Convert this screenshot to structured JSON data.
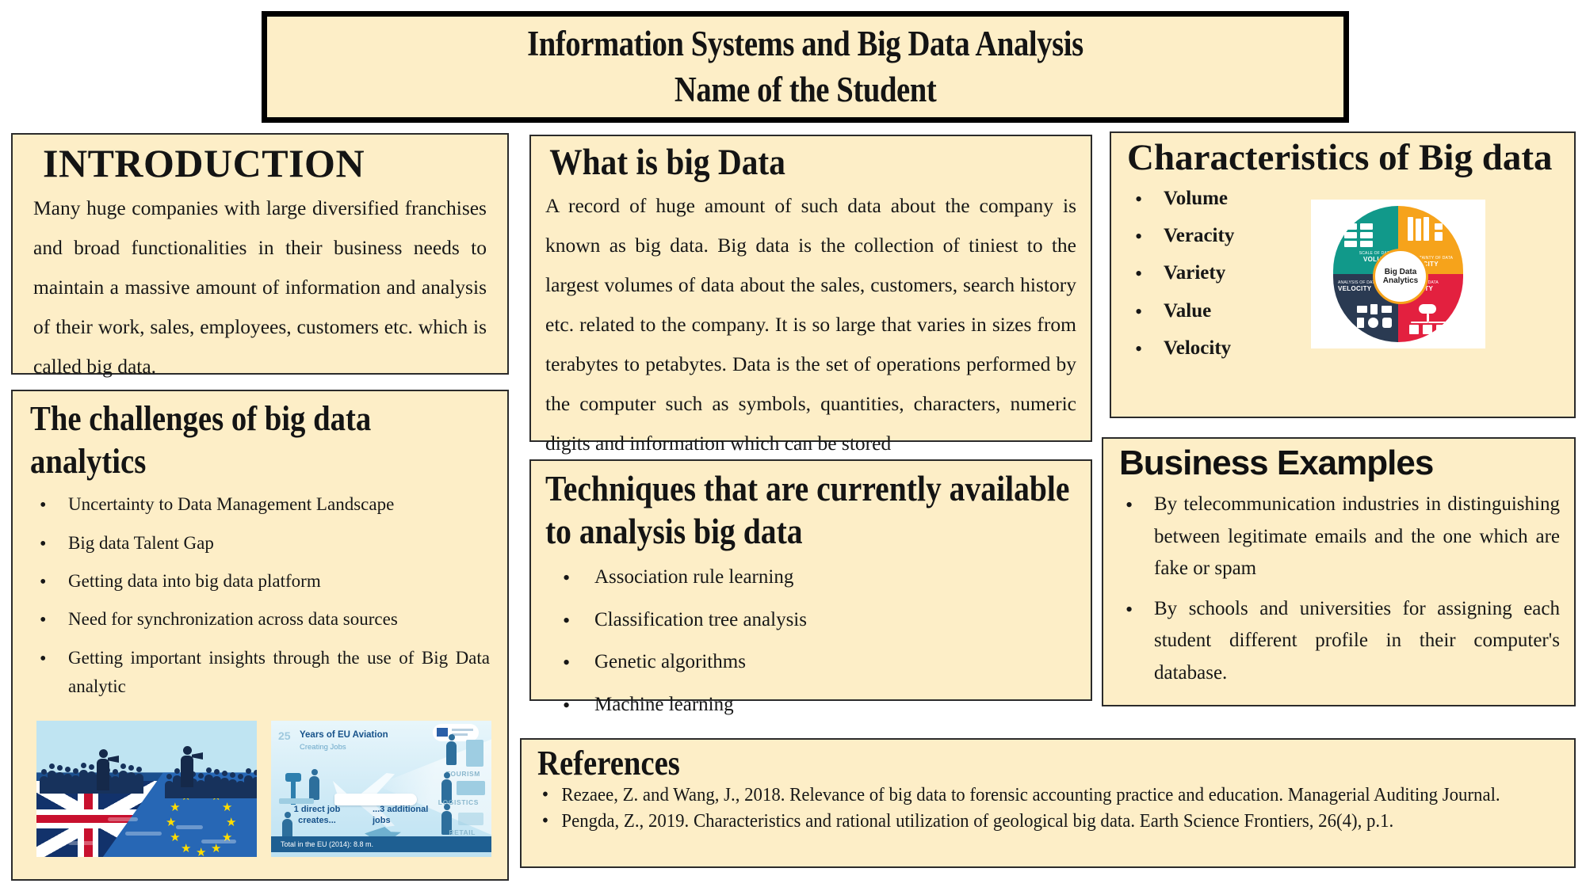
{
  "poster": {
    "title_line1": "Information Systems and Big Data Analysis",
    "title_line2": "Name of the Student",
    "panel_bg_color": "#fdeec7",
    "page_bg_color": "#ffffff"
  },
  "introduction": {
    "heading": "INTRODUCTION",
    "paragraph": "Many huge companies with large diversified franchises and broad functionalities in their business needs to maintain a massive amount of information and analysis of their work, sales, employees, customers etc. which is called big data."
  },
  "challenges": {
    "heading": "The challenges of big data analytics",
    "items": [
      "Uncertainty to Data Management Landscape",
      "Big data Talent Gap",
      "Getting data into big data platform",
      "Need for synchronization across  data sources",
      "Getting important insights through the use of Big Data analytic"
    ],
    "image_brexit": {
      "name": "brexit-uk-eu-boats-illustration"
    },
    "image_aviation": {
      "title": "Years of EU Aviation",
      "subtitle": "Creating Jobs",
      "badge": "25",
      "left_text": "1 direct job creates...",
      "right_text": "...3 additional jobs",
      "labels": [
        "TOURISM",
        "LOGISTICS",
        "RETAIL"
      ],
      "footer": "Total in the EU (2014): 8.8 m."
    }
  },
  "whatis": {
    "heading": "What is big Data",
    "paragraph": "A record of huge amount of such data about the company is known as big data. Big data is the collection of tiniest to the largest volumes of data about the sales, customers, search history etc. related to the company. It is so large that varies in sizes from terabytes to petabytes. Data is the set of operations performed by the computer such as symbols, quantities, characters, numeric digits and information which can be stored"
  },
  "techniques": {
    "heading": "Techniques that are currently available to analysis big data",
    "items": [
      "Association rule learning",
      "Classification tree analysis",
      "Genetic algorithms",
      "Machine learning"
    ]
  },
  "characteristics": {
    "heading": "Characteristics of Big data",
    "items": [
      "Volume",
      "Veracity",
      "Variety",
      "Value",
      "Velocity"
    ],
    "diagram": {
      "center_line1": "Big Data",
      "center_line2": "Analytics",
      "quadrants": [
        {
          "caption": "SCALE OF DATA",
          "label": "VOLUME",
          "color": "#11998a"
        },
        {
          "caption": "UNCERTAINTY OF DATA",
          "label": "VERACITY",
          "color": "#f6a31b"
        },
        {
          "caption": "FORMS OF DATA",
          "label": "VARIETY",
          "color": "#e3203f"
        },
        {
          "caption": "ANALYSIS OF DATA-FLOW",
          "label": "VELOCITY",
          "color": "#2a3a52"
        }
      ]
    }
  },
  "business": {
    "heading": "Business Examples",
    "items": [
      "By telecommunication industries in distinguishing between legitimate emails and the one which are fake or spam",
      "By schools and universities for assigning each student different profile in their computer's database."
    ]
  },
  "references": {
    "heading": "References",
    "items": [
      "Rezaee, Z. and Wang, J., 2018. Relevance of big data to forensic accounting practice and education. Managerial Auditing Journal.",
      "Pengda, Z., 2019. Characteristics and rational utilization of geological big data. Earth Science Frontiers, 26(4), p.1."
    ]
  }
}
